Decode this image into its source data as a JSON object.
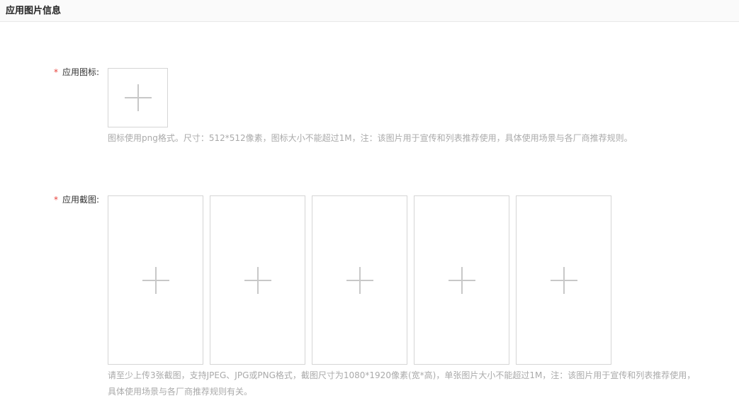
{
  "section": {
    "title": "应用图片信息"
  },
  "icon_field": {
    "required_mark": "*",
    "label": "应用图标:",
    "upload_icon": "plus-icon",
    "hint": "图标使用png格式。尺寸：512*512像素，图标大小不能超过1M，注：该图片用于宣传和列表推荐使用，具体使用场景与各厂商推荐规则。"
  },
  "screenshot_field": {
    "required_mark": "*",
    "label": "应用截图:",
    "upload_icon": "plus-icon",
    "slots": 5,
    "hint_line1": "请至少上传3张截图，支持JPEG、JPG或PNG格式，截图尺寸为1080*1920像素(宽*高)，单张图片大小不能超过1M，注：该图片用于宣传和列表推荐使用，",
    "hint_line2": "具体使用场景与各厂商推荐规则有关。"
  },
  "colors": {
    "required": "#e8423b",
    "hint_text": "#aaaaaa",
    "border": "#d5d5d5",
    "plus": "#c8c8c8"
  }
}
